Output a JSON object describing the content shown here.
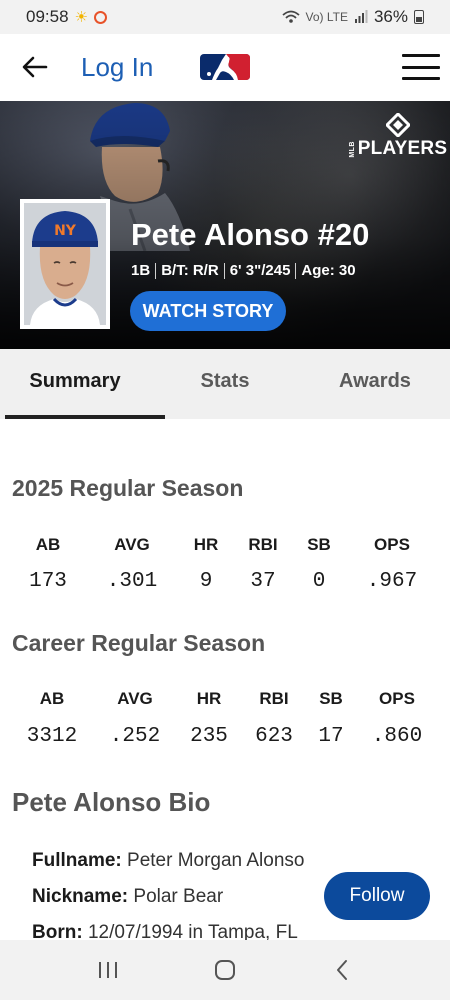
{
  "status_bar": {
    "time": "09:58",
    "signal_text": "Vo) LTE",
    "battery": "36%"
  },
  "header": {
    "login_label": "Log In"
  },
  "hero": {
    "brand_prefix": "MLB",
    "brand_word": "PLAYERS",
    "player_name": "Pete Alonso #20",
    "position": "1B",
    "bats_throws": "B/T: R/R",
    "height_weight": "6' 3\"/245",
    "age": "Age: 30",
    "watch_label": "WATCH STORY"
  },
  "tabs": [
    {
      "label": "Summary",
      "active": true
    },
    {
      "label": "Stats",
      "active": false
    },
    {
      "label": "Awards",
      "active": false
    }
  ],
  "season": {
    "title": "2025 Regular Season",
    "headers": [
      "AB",
      "AVG",
      "HR",
      "RBI",
      "SB",
      "OPS"
    ],
    "values": [
      "173",
      ".301",
      "9",
      "37",
      "0",
      ".967"
    ]
  },
  "career": {
    "title": "Career Regular Season",
    "headers": [
      "AB",
      "AVG",
      "HR",
      "RBI",
      "SB",
      "OPS"
    ],
    "values": [
      "3312",
      ".252",
      "235",
      "623",
      "17",
      ".860"
    ]
  },
  "bio": {
    "title": "Pete Alonso Bio",
    "fullname_label": "Fullname:",
    "fullname": "Peter Morgan Alonso",
    "nickname_label": "Nickname:",
    "nickname": "Polar Bear",
    "born_label": "Born:",
    "born": "12/07/1994 in Tampa, FL"
  },
  "follow_label": "Follow",
  "colors": {
    "accent_blue": "#1f6fd6",
    "follow_blue": "#0c4a9c",
    "link_blue": "#1d5fb4"
  }
}
